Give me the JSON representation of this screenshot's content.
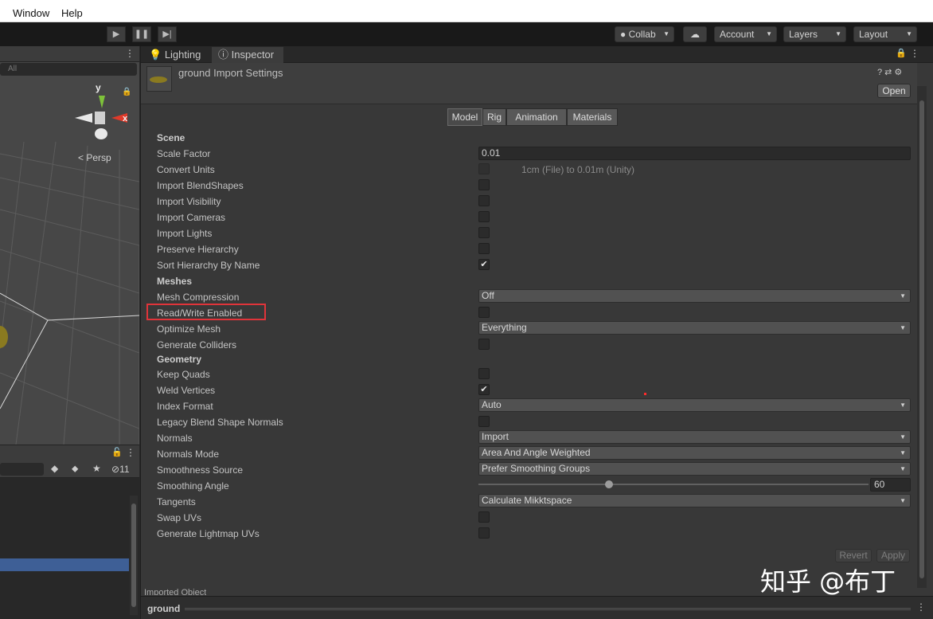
{
  "menu": [
    "Window",
    "Help"
  ],
  "toolbar": {
    "collab": "Collab",
    "account": "Account",
    "layers": "Layers",
    "layout": "Layout"
  },
  "scene": {
    "search_placeholder": "All",
    "axis_y": "y",
    "axis_x": "x",
    "persp": "< Persp"
  },
  "hierarchy": {
    "hidden_count": "11"
  },
  "inspector": {
    "tabs": [
      "Lighting",
      "Inspector"
    ],
    "title": "ground Import Settings",
    "open_label": "Open",
    "mode_tabs": [
      "Model",
      "Rig",
      "Animation",
      "Materials"
    ],
    "sections": {
      "scene": "Scene",
      "meshes": "Meshes",
      "geometry": "Geometry"
    },
    "labels": {
      "scale_factor": "Scale Factor",
      "convert_units": "Convert Units",
      "import_blendshapes": "Import BlendShapes",
      "import_visibility": "Import Visibility",
      "import_cameras": "Import Cameras",
      "import_lights": "Import Lights",
      "preserve_hierarchy": "Preserve Hierarchy",
      "sort_hierarchy": "Sort Hierarchy By Name",
      "mesh_compression": "Mesh Compression",
      "read_write": "Read/Write Enabled",
      "optimize_mesh": "Optimize Mesh",
      "generate_colliders": "Generate Colliders",
      "keep_quads": "Keep Quads",
      "weld_vertices": "Weld Vertices",
      "index_format": "Index Format",
      "legacy_blend": "Legacy Blend Shape Normals",
      "normals": "Normals",
      "normals_mode": "Normals Mode",
      "smoothness_source": "Smoothness Source",
      "smoothing_angle": "Smoothing Angle",
      "tangents": "Tangents",
      "swap_uvs": "Swap UVs",
      "lightmap_uvs": "Generate Lightmap UVs"
    },
    "values": {
      "scale_factor": "0.01",
      "convert_units_hint": "1cm (File) to 0.01m (Unity)",
      "mesh_compression": "Off",
      "optimize_mesh": "Everything",
      "index_format": "Auto",
      "normals": "Import",
      "normals_mode": "Area And Angle Weighted",
      "smoothness_source": "Prefer Smoothing Groups",
      "smoothing_angle": "60",
      "tangents": "Calculate Mikktspace"
    },
    "checks": {
      "convert_units": false,
      "import_blendshapes": false,
      "import_visibility": false,
      "import_cameras": false,
      "import_lights": false,
      "preserve_hierarchy": false,
      "sort_hierarchy": true,
      "read_write": false,
      "generate_colliders": false,
      "keep_quads": false,
      "weld_vertices": true,
      "legacy_blend": false,
      "swap_uvs": false,
      "lightmap_uvs": false
    },
    "revert": "Revert",
    "apply": "Apply",
    "imported_object": "Imported Object",
    "asset_name": "ground"
  },
  "watermark": "知乎 @布丁",
  "colors": {
    "highlight": "#e0343a",
    "selection": "#3e5f96"
  }
}
